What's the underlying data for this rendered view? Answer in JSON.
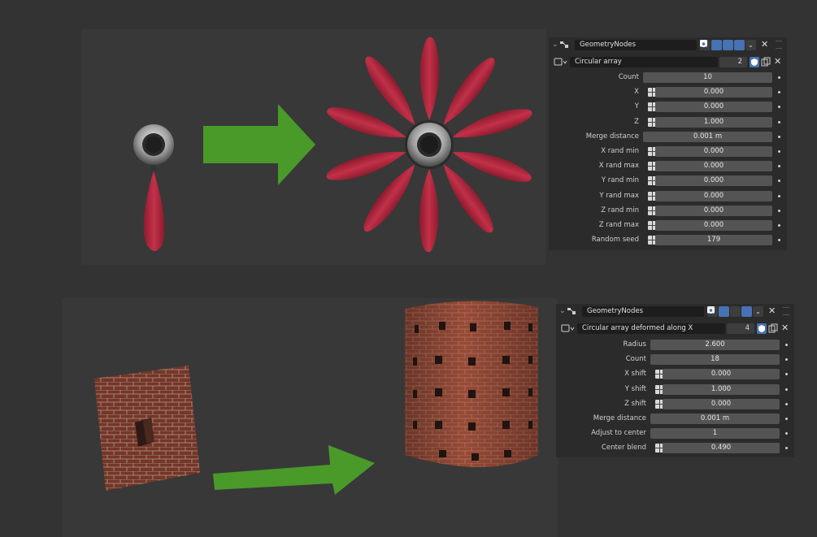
{
  "panel_top": {
    "node_tree": "GeometryNodes",
    "modifier_name": "Circular array",
    "users": "2",
    "params": [
      {
        "label": "Count",
        "value": "10",
        "socket": false
      },
      {
        "label": "X",
        "value": "0.000",
        "socket": true
      },
      {
        "label": "Y",
        "value": "0.000",
        "socket": true
      },
      {
        "label": "Z",
        "value": "1.000",
        "socket": true
      },
      {
        "label": "Merge distance",
        "value": "0.001 m",
        "socket": false
      },
      {
        "label": "X rand min",
        "value": "0.000",
        "socket": true
      },
      {
        "label": "X rand max",
        "value": "0.000",
        "socket": true
      },
      {
        "label": "Y rand min",
        "value": "0.000",
        "socket": true
      },
      {
        "label": "Y rand max",
        "value": "0.000",
        "socket": true
      },
      {
        "label": "Z rand min",
        "value": "0.000",
        "socket": true
      },
      {
        "label": "Z rand max",
        "value": "0.000",
        "socket": true
      },
      {
        "label": "Random seed",
        "value": "179",
        "socket": true
      }
    ]
  },
  "panel_bottom": {
    "node_tree": "GeometryNodes",
    "modifier_name": "Circular array deformed along X",
    "users": "4",
    "params": [
      {
        "label": "Radius",
        "value": "2.600",
        "socket": false
      },
      {
        "label": "Count",
        "value": "18",
        "socket": false
      },
      {
        "label": "X shift",
        "value": "0.000",
        "socket": true
      },
      {
        "label": "Y shift",
        "value": "1.000",
        "socket": true
      },
      {
        "label": "Z shift",
        "value": "0.000",
        "socket": true
      },
      {
        "label": "Merge distance",
        "value": "0.001 m",
        "socket": false
      },
      {
        "label": "Adjust to center",
        "value": "1",
        "socket": false
      },
      {
        "label": "Center blend",
        "value": "0.490",
        "socket": true
      }
    ]
  },
  "colors": {
    "arrow_green": "#4a9a2a",
    "petal_red": "#b8293f",
    "brick": "#8a4030",
    "accent_blue": "#4772b3"
  }
}
